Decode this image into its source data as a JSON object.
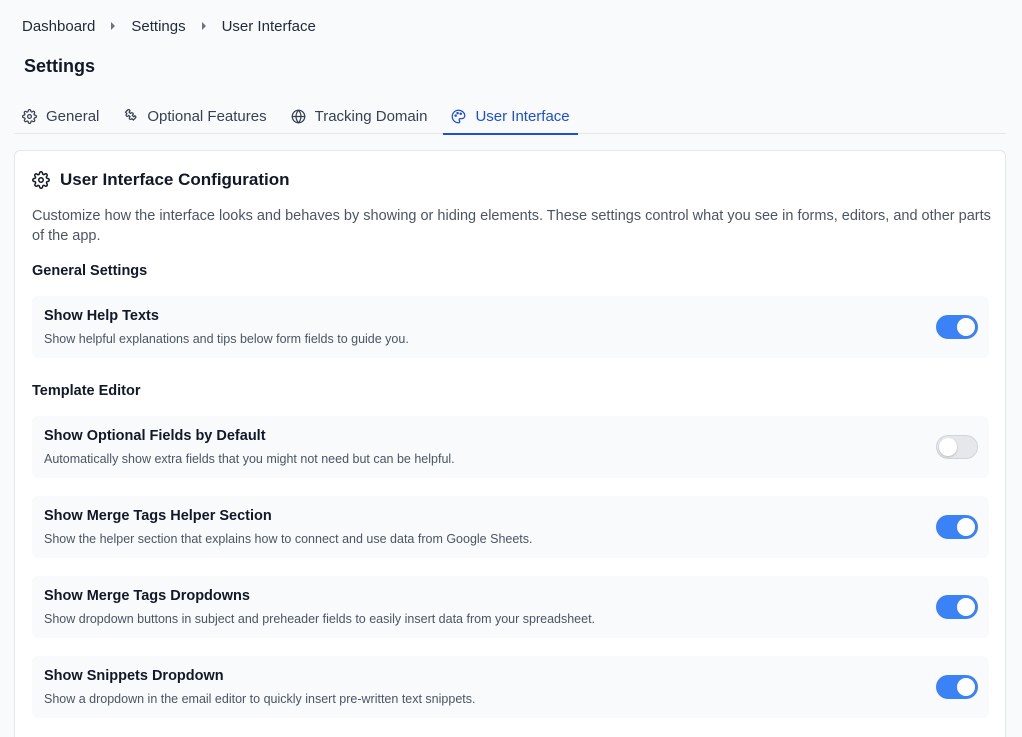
{
  "breadcrumb": [
    "Dashboard",
    "Settings",
    "User Interface"
  ],
  "page_title": "Settings",
  "tabs": [
    {
      "label": "General",
      "icon": "gear-icon"
    },
    {
      "label": "Optional Features",
      "icon": "puzzle-icon"
    },
    {
      "label": "Tracking Domain",
      "icon": "globe-icon"
    },
    {
      "label": "User Interface",
      "icon": "palette-icon",
      "active": true
    }
  ],
  "card": {
    "title": "User Interface Configuration",
    "icon": "gear-icon",
    "description": "Customize how the interface looks and behaves by showing or hiding elements. These settings control what you see in forms, editors, and other parts of the app."
  },
  "sections": [
    {
      "title": "General Settings",
      "settings": [
        {
          "title": "Show Help Texts",
          "description": "Show helpful explanations and tips below form fields to guide you.",
          "enabled": true
        }
      ]
    },
    {
      "title": "Template Editor",
      "settings": [
        {
          "title": "Show Optional Fields by Default",
          "description": "Automatically show extra fields that you might not need but can be helpful.",
          "enabled": false
        },
        {
          "title": "Show Merge Tags Helper Section",
          "description": "Show the helper section that explains how to connect and use data from Google Sheets.",
          "enabled": true
        },
        {
          "title": "Show Merge Tags Dropdowns",
          "description": "Show dropdown buttons in subject and preheader fields to easily insert data from your spreadsheet.",
          "enabled": true
        },
        {
          "title": "Show Snippets Dropdown",
          "description": "Show a dropdown in the email editor to quickly insert pre-written text snippets.",
          "enabled": true
        }
      ]
    }
  ],
  "colors": {
    "accent": "#3b82f6",
    "active_tab": "#1d4ed8",
    "toggle_off": "#e5e7eb"
  }
}
